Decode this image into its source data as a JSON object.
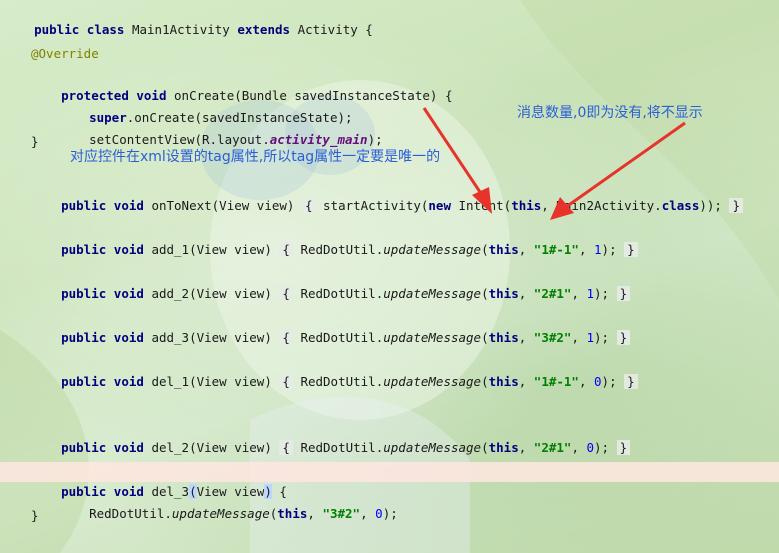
{
  "code": {
    "l1": {
      "kw1": "public",
      "kw2": "class",
      "name": "Main1Activity",
      "kw3": "extends",
      "parent": "Activity {"
    },
    "l2": {
      "annot": "@Override"
    },
    "l3": {
      "kw1": "protected",
      "kw2": "void",
      "rest": "onCreate(Bundle savedInstanceState) {"
    },
    "l4": {
      "kw": "super",
      "rest": ".onCreate(savedInstanceState);"
    },
    "l5": {
      "pre": "setContentView(R.layout.",
      "field": "activity_main",
      "post": ");"
    },
    "l6": {
      "text": "}"
    },
    "l7": {
      "kw1": "public",
      "kw2": "void",
      "sig": "onToNext(View view)",
      "open": "{",
      "pre": "startActivity(",
      "kw3": "new",
      "mid": "Intent(",
      "kw4": "this",
      "post": ", Main2Activity.",
      "kw5": "class",
      "end": "));",
      "close": "}"
    },
    "l8": {
      "kw1": "public",
      "kw2": "void",
      "sig": "add_1(View view)",
      "open": "{",
      "pre": "RedDotUtil.",
      "mth": "updateMessage",
      "paren": "(",
      "kw3": "this",
      "comma": ",",
      "str": "\"1#-1\"",
      "comma2": ",",
      "num": "1",
      "end": ");",
      "close": "}"
    },
    "l9": {
      "kw1": "public",
      "kw2": "void",
      "sig": "add_2(View view)",
      "open": "{",
      "pre": "RedDotUtil.",
      "mth": "updateMessage",
      "paren": "(",
      "kw3": "this",
      "comma": ",",
      "str": "\"2#1\"",
      "comma2": ",",
      "num": "1",
      "end": ");",
      "close": "}"
    },
    "l10": {
      "kw1": "public",
      "kw2": "void",
      "sig": "add_3(View view)",
      "open": "{",
      "pre": "RedDotUtil.",
      "mth": "updateMessage",
      "paren": "(",
      "kw3": "this",
      "comma": ",",
      "str": "\"3#2\"",
      "comma2": ",",
      "num": "1",
      "end": ");",
      "close": "}"
    },
    "l11": {
      "kw1": "public",
      "kw2": "void",
      "sig": "del_1(View view)",
      "open": "{",
      "pre": "RedDotUtil.",
      "mth": "updateMessage",
      "paren": "(",
      "kw3": "this",
      "comma": ",",
      "str": "\"1#-1\"",
      "comma2": ",",
      "num": "0",
      "end": ");",
      "close": "}"
    },
    "l12": {
      "kw1": "public",
      "kw2": "void",
      "sig": "del_2(View view)",
      "open": "{",
      "pre": "RedDotUtil.",
      "mth": "updateMessage",
      "paren": "(",
      "kw3": "this",
      "comma": ",",
      "str": "\"2#1\"",
      "comma2": ",",
      "num": "0",
      "end": ");",
      "close": "}"
    },
    "l13": {
      "kw1": "public",
      "kw2": "void",
      "name": "del_3",
      "sig": "View view",
      "open": "{"
    },
    "l14": {
      "pre": "RedDotUtil.",
      "mth": "updateMessage",
      "paren": "(",
      "kw3": "this",
      "comma": ",",
      "str": "\"3#2\"",
      "comma2": ",",
      "num": "0",
      "end": ");"
    },
    "l15": {
      "text": "}"
    }
  },
  "notes": {
    "left": "对应控件在xml设置的tag属性,所以tag属性一定要是唯一的",
    "right": "消息数量,0即为没有,将不显示"
  },
  "colors": {
    "arrow": "#e8332a",
    "note": "#2b5fd6",
    "highlight": "#ffe6e1"
  }
}
